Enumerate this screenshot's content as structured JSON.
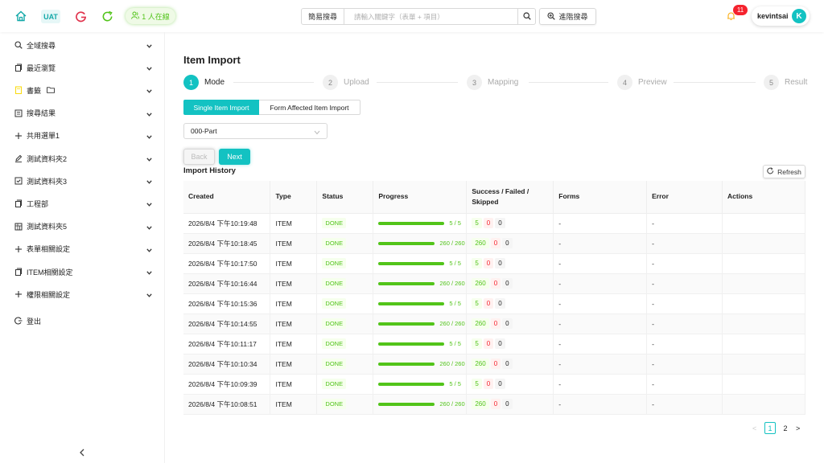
{
  "header": {
    "env_badge": "UAT",
    "online_text": "1 人在線",
    "search_mode": "簡易搜尋",
    "search_placeholder": "請輸入關鍵字（表單 + 項目）",
    "advanced_search": "進階搜尋",
    "notification_count": "11",
    "username": "kevintsai",
    "avatar_letter": "K",
    "accent_color": "#13c2c2"
  },
  "sidebar": {
    "items": [
      {
        "label": "全域搜尋",
        "icon": "search-icon"
      },
      {
        "label": "最近瀏覽",
        "icon": "copy-icon"
      },
      {
        "label": "書籤",
        "icon": "bookmark-icon"
      },
      {
        "label": "搜尋結果",
        "icon": "list-icon"
      },
      {
        "label": "共用選單1",
        "icon": "plus-icon"
      },
      {
        "label": "測試資料夾2",
        "icon": "edit-icon"
      },
      {
        "label": "測試資料夾3",
        "icon": "checkbox-icon"
      },
      {
        "label": "工程部",
        "icon": "copy-icon"
      },
      {
        "label": "測試資料夾5",
        "icon": "table-icon"
      },
      {
        "label": "表單相關設定",
        "icon": "plus-icon"
      },
      {
        "label": "ITEM相關設定",
        "icon": "copy-icon"
      },
      {
        "label": "權限相關設定",
        "icon": "plus-icon"
      },
      {
        "label": "登出",
        "icon": "logout-icon"
      }
    ],
    "collapse_glyph": "<"
  },
  "page": {
    "title": "Item Import",
    "steps": [
      {
        "num": "1",
        "label": "Mode"
      },
      {
        "num": "2",
        "label": "Upload"
      },
      {
        "num": "3",
        "label": "Mapping"
      },
      {
        "num": "4",
        "label": "Preview"
      },
      {
        "num": "5",
        "label": "Result"
      }
    ],
    "mode_tabs": [
      "Single Item Import",
      "Form Affected Item Import"
    ],
    "selected_value": "000-Part",
    "back_label": "Back",
    "next_label": "Next",
    "history_title": "Import History",
    "refresh_label": "Refresh"
  },
  "table": {
    "headers": [
      "Created",
      "Type",
      "Status",
      "Progress",
      "Success / Failed / Skipped",
      "Forms",
      "Error",
      "Actions"
    ],
    "rows": [
      {
        "created": "2026/8/4 下午10:19:48",
        "type": "ITEM",
        "status": "DONE",
        "progress_text": "5 / 5",
        "progress": 1.0,
        "success": "5",
        "failed": "0",
        "skipped": "0",
        "forms": "-",
        "error": "-"
      },
      {
        "created": "2026/8/4 下午10:18:45",
        "type": "ITEM",
        "status": "DONE",
        "progress_text": "260 / 260",
        "progress": 1.0,
        "success": "260",
        "failed": "0",
        "skipped": "0",
        "forms": "-",
        "error": "-"
      },
      {
        "created": "2026/8/4 下午10:17:50",
        "type": "ITEM",
        "status": "DONE",
        "progress_text": "5 / 5",
        "progress": 1.0,
        "success": "5",
        "failed": "0",
        "skipped": "0",
        "forms": "-",
        "error": "-"
      },
      {
        "created": "2026/8/4 下午10:16:44",
        "type": "ITEM",
        "status": "DONE",
        "progress_text": "260 / 260",
        "progress": 1.0,
        "success": "260",
        "failed": "0",
        "skipped": "0",
        "forms": "-",
        "error": "-"
      },
      {
        "created": "2026/8/4 下午10:15:36",
        "type": "ITEM",
        "status": "DONE",
        "progress_text": "5 / 5",
        "progress": 1.0,
        "success": "5",
        "failed": "0",
        "skipped": "0",
        "forms": "-",
        "error": "-"
      },
      {
        "created": "2026/8/4 下午10:14:55",
        "type": "ITEM",
        "status": "DONE",
        "progress_text": "260 / 260",
        "progress": 1.0,
        "success": "260",
        "failed": "0",
        "skipped": "0",
        "forms": "-",
        "error": "-"
      },
      {
        "created": "2026/8/4 下午10:11:17",
        "type": "ITEM",
        "status": "DONE",
        "progress_text": "5 / 5",
        "progress": 1.0,
        "success": "5",
        "failed": "0",
        "skipped": "0",
        "forms": "-",
        "error": "-"
      },
      {
        "created": "2026/8/4 下午10:10:34",
        "type": "ITEM",
        "status": "DONE",
        "progress_text": "260 / 260",
        "progress": 1.0,
        "success": "260",
        "failed": "0",
        "skipped": "0",
        "forms": "-",
        "error": "-"
      },
      {
        "created": "2026/8/4 下午10:09:39",
        "type": "ITEM",
        "status": "DONE",
        "progress_text": "5 / 5",
        "progress": 1.0,
        "success": "5",
        "failed": "0",
        "skipped": "0",
        "forms": "-",
        "error": "-"
      },
      {
        "created": "2026/8/4 下午10:08:51",
        "type": "ITEM",
        "status": "DONE",
        "progress_text": "260 / 260",
        "progress": 1.0,
        "success": "260",
        "failed": "0",
        "skipped": "0",
        "forms": "-",
        "error": "-"
      }
    ]
  },
  "pagination": {
    "pages": [
      "1",
      "2"
    ],
    "current": "1",
    "prev": "<",
    "next": ">"
  }
}
